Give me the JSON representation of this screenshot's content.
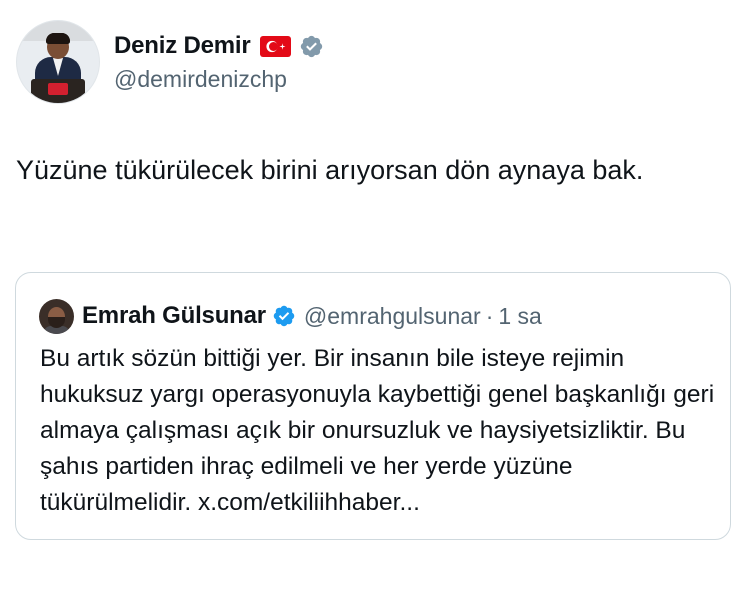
{
  "author": {
    "display_name": "Deniz Demir",
    "handle": "@demirdenizchp",
    "flag_icon": "turkey-flag-icon",
    "verified_icon": "verified-badge-gray"
  },
  "tweet": {
    "text": "Yüzüne tükürülecek birini arıyorsan dön aynaya bak."
  },
  "quoted_tweet": {
    "display_name": "Emrah Gülsunar",
    "handle": "@emrahgulsunar",
    "separator": "·",
    "time": "1 sa",
    "verified_icon": "verified-badge-blue",
    "text": "Bu artık sözün bittiği yer. Bir insanın bile isteye rejimin hukuksuz yargı operasyonuyla kaybettiği genel başkanlığı geri almaya çalışması açık bir onursuzluk ve haysiyetsizliktir. Bu şahıs partiden ihraç edilmeli ve her yerde yüzüne tükürülmelidir. x.com/etkiliihhaber..."
  },
  "colors": {
    "text_primary": "#0f1419",
    "text_secondary": "#536471",
    "verified_blue": "#1d9bf0",
    "verified_gray": "#829aab",
    "border": "#cfd9de",
    "flag_red": "#e30a17"
  }
}
